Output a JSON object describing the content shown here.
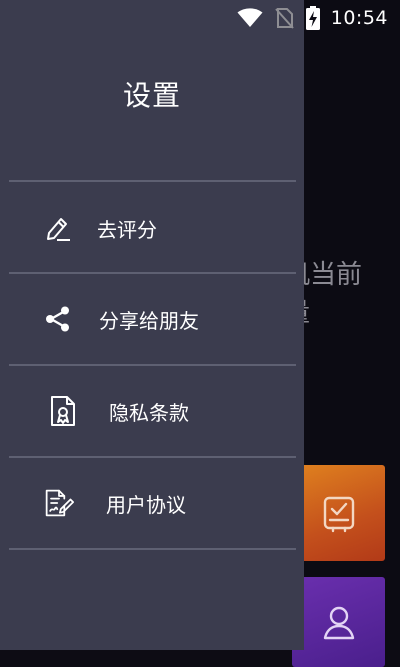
{
  "status_bar": {
    "time": "10:54",
    "icons": [
      "wifi-icon",
      "no-sim-icon",
      "battery-charging-icon"
    ]
  },
  "drawer": {
    "title": "设置",
    "items": [
      {
        "label": "去评分",
        "icon": "pen-rate-icon"
      },
      {
        "label": "分享给朋友",
        "icon": "share-icon"
      },
      {
        "label": "隐私条款",
        "icon": "privacy-document-icon"
      },
      {
        "label": "用户协议",
        "icon": "agreement-document-icon"
      }
    ]
  },
  "background": {
    "text_line1": "机当前",
    "text_line2": "量",
    "cards": [
      {
        "icon": "checklist-icon",
        "color": "#d4641d"
      },
      {
        "icon": "user-icon",
        "color": "#5a27a0"
      }
    ]
  },
  "colors": {
    "drawer_bg": "#3b3c4e",
    "divider": "#5e6072",
    "screen_bg": "#0c0b13",
    "text": "#ffffff"
  }
}
